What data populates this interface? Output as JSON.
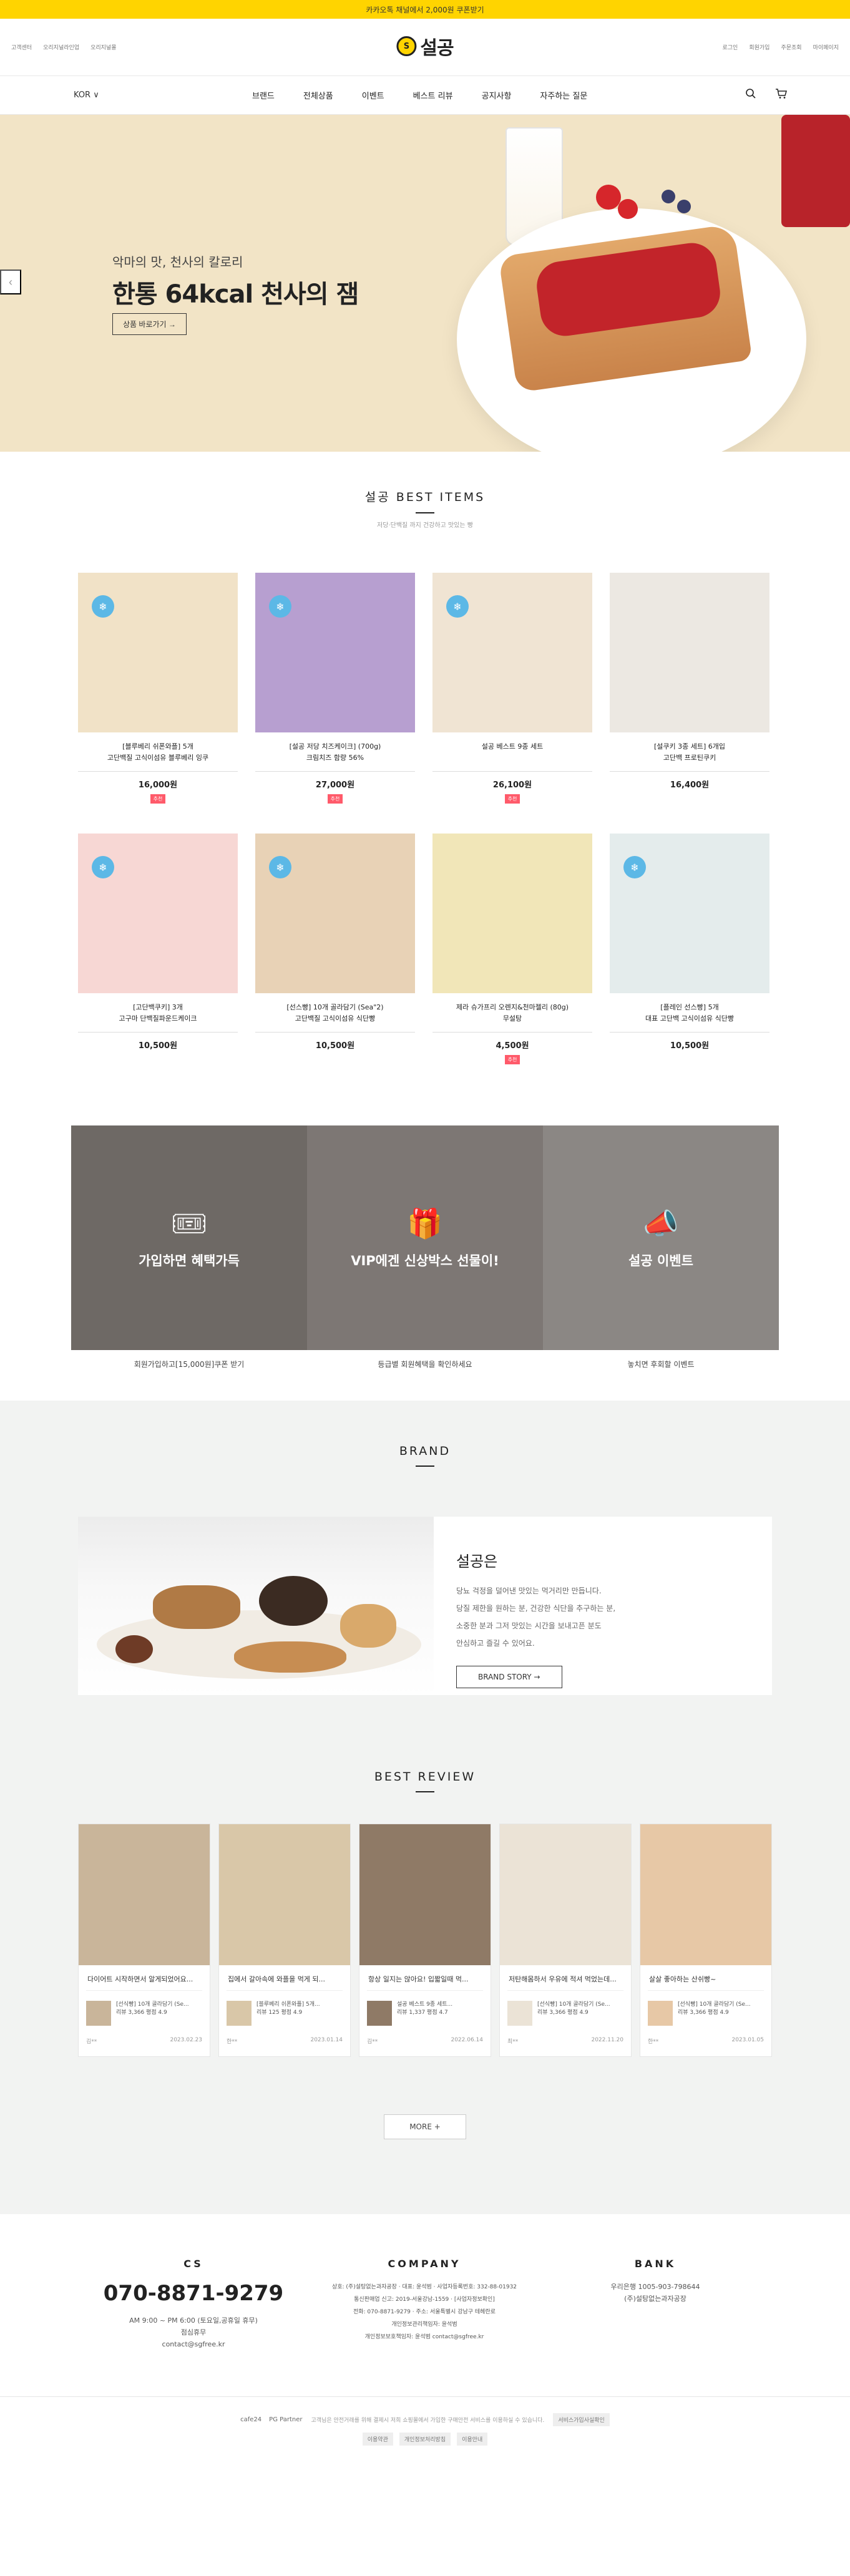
{
  "topbar": {
    "text": "카카오톡 채널에서 2,000원 쿠폰받기"
  },
  "header": {
    "left_links": [
      "고객센터",
      "오리지널라인업",
      "오리지널몰"
    ],
    "logo_text": "설공",
    "right_links": [
      "로그인",
      "회원가입",
      "주문조회",
      "마이페이지"
    ]
  },
  "nav": {
    "lang": "KOR ∨",
    "items": [
      "브랜드",
      "전체상품",
      "이벤트",
      "베스트 리뷰",
      "공지사항",
      "자주하는 질문"
    ]
  },
  "hero": {
    "sub": "악마의 맛, 천사의 칼로리",
    "title": "한통 64kcal 천사의 잼",
    "button": "상품 바로가기 →",
    "prev": "‹"
  },
  "best": {
    "title": "설공 BEST ITEMS",
    "subtitle": "저당·단백질 까지 건강하고 맛있는 빵",
    "products": [
      {
        "name1": "[블루베리 쉬폰와플] 5개",
        "name2": "고단백질 고식이섬유 블루베리 잉쿠",
        "price": "16,000원",
        "badge": "추천",
        "frozen": true,
        "color": "#f1e2c7"
      },
      {
        "name1": "[설공 저당 치즈케이크] (700g)",
        "name2": "크림치즈 함량 56%",
        "price": "27,000원",
        "badge": "추천",
        "frozen": true,
        "color": "#b79fd0"
      },
      {
        "name1": "설공 베스트 9종 세트",
        "name2": "",
        "price": "26,100원",
        "badge": "추천",
        "frozen": true,
        "color": "#f0e4d3"
      },
      {
        "name1": "[설쿠키 3종 세트] 6개입",
        "name2": "고단백 프로틴쿠키",
        "price": "16,400원",
        "badge": "",
        "frozen": false,
        "color": "#ece8e2"
      },
      {
        "name1": "[고단백쿠키] 3개",
        "name2": "고구마 단백질파운드케이크",
        "price": "10,500원",
        "badge": "",
        "frozen": true,
        "color": "#f7d7d4"
      },
      {
        "name1": "[선스빵] 10개 골라담기 (Sea\"2)",
        "name2": "고단백질 고식이섬유 식단빵",
        "price": "10,500원",
        "badge": "",
        "frozen": true,
        "color": "#e8d2b6"
      },
      {
        "name1": "제라 슈가프리 오렌지&천마젤리 (80g)",
        "name2": "무설탕",
        "price": "4,500원",
        "badge": "추천",
        "frozen": false,
        "color": "#f1e6b8"
      },
      {
        "name1": "[플레인 선스빵] 5개",
        "name2": "대표 고단백 고식이섬유 식단빵",
        "price": "10,500원",
        "badge": "",
        "frozen": true,
        "color": "#e4ecec"
      }
    ]
  },
  "banners": [
    {
      "title": "가입하면 혜택가득",
      "caption": "회원가입하고[15,000원]쿠폰 받기",
      "icon": "coupon-icon",
      "glyph": "🎟",
      "bg": "#6e6965"
    },
    {
      "title": "VIP에겐 신상박스 선물이!",
      "caption": "등급별 회원혜택을 확인하세요",
      "icon": "gift-icon",
      "glyph": "🎁",
      "bg": "#7d7774"
    },
    {
      "title": "설공 이벤트",
      "caption": "놓치면 후회할 이벤트",
      "icon": "megaphone-icon",
      "glyph": "📣",
      "bg": "#8b8784"
    }
  ],
  "brand": {
    "section_title": "BRAND",
    "heading": "설공은",
    "lines": [
      "당뇨 걱정을 덜어낸 맛있는 먹거리만 만듭니다.",
      "당질 제한을 원하는 분, 건강한 식단을 추구하는 분,",
      "소중한 분과 그저 맛있는 시간을 보내고픈 분도",
      "안심하고 즐길 수 있어요."
    ],
    "button": "BRAND STORY →"
  },
  "review": {
    "title": "BEST REVIEW",
    "items": [
      {
        "text": "다이어트 시작하면서 알게되었어요...",
        "product": "[선식빵] 10개 골라담기 (Se...",
        "meta": "리뷰 3,366 평점 4.9",
        "author": "김**",
        "date": "2023.02.23",
        "color": "#c9b59a"
      },
      {
        "text": "집에서 갈아속에 와플을 먹게 되...",
        "product": "[블루베리 쉬폰와플] 5개...",
        "meta": "리뷰 125 평점 4.9",
        "author": "한**",
        "date": "2023.01.14",
        "color": "#d9c7a8"
      },
      {
        "text": "항상 일지는 않아요! 입짧일때 먹...",
        "product": "설공 베스트 9종 세트...",
        "meta": "리뷰 1,337 평점 4.7",
        "author": "김**",
        "date": "2022.06.14",
        "color": "#8f7a66"
      },
      {
        "text": "저탄해몸하서 우유에 적셔 먹었는데...",
        "product": "[선식빵] 10개 골라담기 (Se...",
        "meta": "리뷰 3,366 평점 4.9",
        "author": "최**",
        "date": "2022.11.20",
        "color": "#ebe3d6"
      },
      {
        "text": "살살 좋아하는 산쉬빵~",
        "product": "[선식빵] 10개 골라담기 (Se...",
        "meta": "리뷰 3,366 평점 4.9",
        "author": "한**",
        "date": "2023.01.05",
        "color": "#e7c8a6"
      }
    ],
    "more": "MORE +"
  },
  "footer": {
    "cs_title": "CS",
    "tel": "070-8871-9279",
    "cs_lines": [
      "AM 9:00 ~ PM 6:00 (토요일,공휴일 휴무)",
      "점심휴무",
      "contact@sgfree.kr"
    ],
    "company_title": "COMPANY",
    "company_lines": [
      "상호: (주)설탕없는과자공장 · 대표: 윤석범 · 사업자등록번호: 332-88-01932",
      "통신판매업 신고: 2019-서울강남-1559 · [사업자정보확인]",
      "전화: 070-8871-9279 · 주소: 서울특별시 강남구 테헤란로",
      "개인정보관리책임자: 윤석범",
      "개인정보보호책임자: 윤석범 contact@sgfree.kr"
    ],
    "bank_title": "BANK",
    "bank_lines": [
      "우리은행 1005-903-798644",
      "(주)설탕없는과자공장"
    ],
    "bottom_logos": [
      "cafe24",
      "PG Partner"
    ],
    "bottom_text": "고객님은 안전거래를 위해 결제시 저희 쇼핑몰에서 가입한 구매안전 서비스를 이용하실 수 있습니다.",
    "bottom_chip": "서비스가입사실확인",
    "links": [
      "이용약관",
      "개인정보처리방침",
      "이용안내"
    ]
  }
}
